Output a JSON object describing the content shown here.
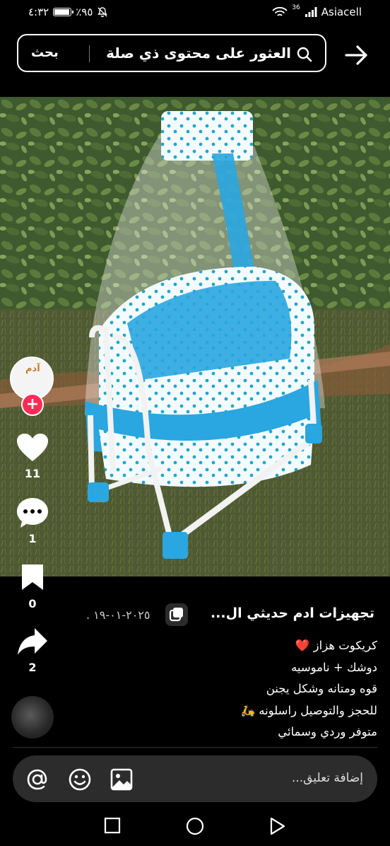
{
  "status_bar": {
    "time": "٤:٣٢",
    "battery_percent": "٪٩٥",
    "battery_level": 0.95,
    "network_type": "36",
    "carrier": "Asiacell"
  },
  "search": {
    "query": "العثور على محتوى ذي صلة",
    "button_label": "بحث"
  },
  "post": {
    "avatar_text": "آدم",
    "like_count": "11",
    "comment_count": "1",
    "save_count": "0",
    "share_count": "2",
    "title": "تجهيزات ادم حديثي ال...",
    "date": "٢٠٢٥-٠١-١٩ .",
    "description_lines": [
      "كريكوت هزاز ❤️",
      "دوشك + ناموسيه",
      "قوه ومتانه وشكل يجنن",
      "للحجز والتوصيل راسلونه 🛵",
      "متوفر وردي وسمائي"
    ]
  },
  "comment": {
    "placeholder": "إضافة تعليق..."
  },
  "colors": {
    "like_red": "#ff2b55",
    "crib_blue": "#2aa6e0"
  }
}
